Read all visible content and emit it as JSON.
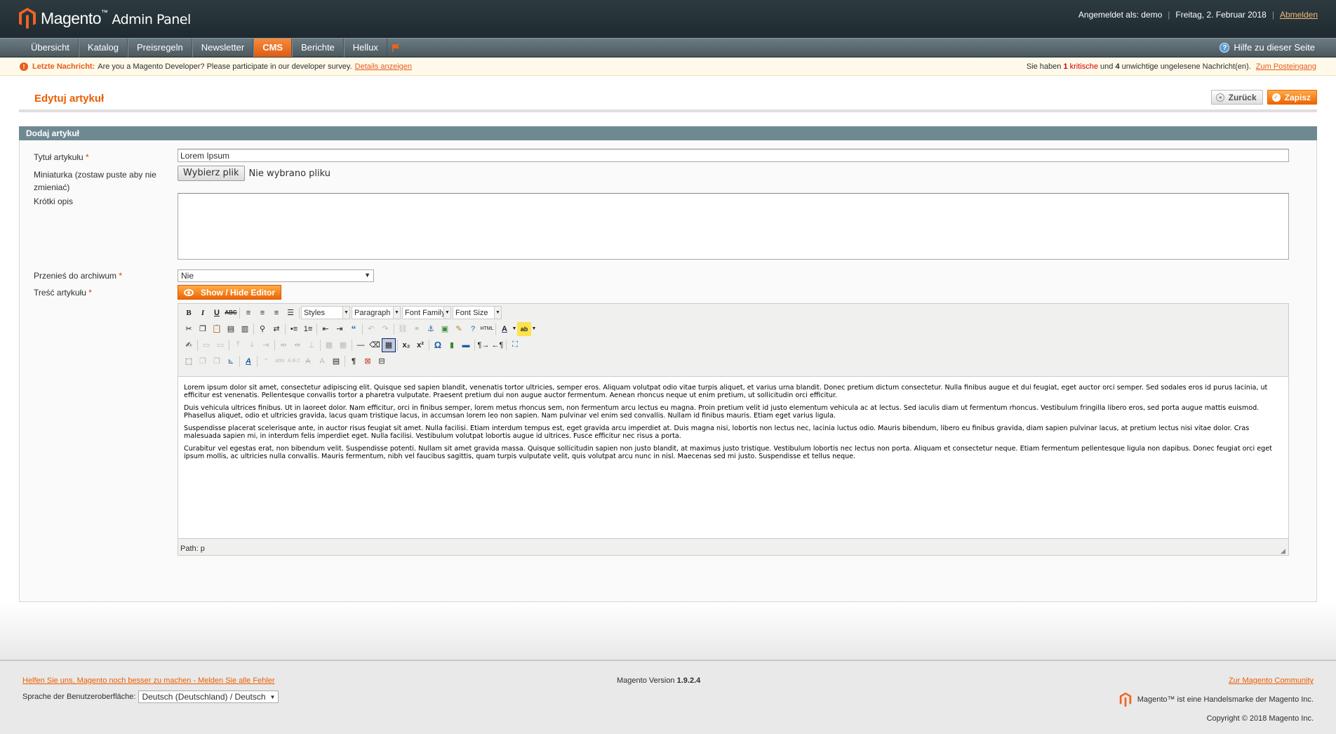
{
  "header": {
    "logo_brand": "Magento",
    "logo_tm": "™",
    "logo_suffix": "Admin Panel",
    "logged_in": "Angemeldet als: demo",
    "date": "Freitag, 2. Februar 2018",
    "logout": "Abmelden"
  },
  "nav": {
    "items": [
      "Übersicht",
      "Katalog",
      "Preisregeln",
      "Newsletter",
      "CMS",
      "Berichte",
      "Hellux"
    ],
    "active": "CMS",
    "help": "Hilfe zu dieser Seite"
  },
  "notice": {
    "label": "Letzte Nachricht:",
    "text": "Are you a Magento Developer? Please participate in our developer survey.",
    "link": "Details anzeigen",
    "right_prefix": "Sie haben",
    "crit_count": "1",
    "crit_label": "kritische",
    "mid": "und",
    "major_count": "4",
    "right_suffix": "unwichtige ungelesene Nachricht(en).",
    "inbox_link": "Zum Posteingang"
  },
  "page": {
    "title": "Edytuj artykuł",
    "back": "Zurück",
    "save": "Zapisz"
  },
  "form": {
    "section": "Dodaj artykuł",
    "title_label": "Tytuł artykułu",
    "title_value": "Lorem Ipsum",
    "thumb_label": "Miniaturka (zostaw puste aby nie zmieniać)",
    "file_button": "Wybierz plik",
    "file_status": "Nie wybrano pliku",
    "short_label": "Krótki opis",
    "archive_label": "Przenieś do archiwum",
    "archive_value": "Nie",
    "content_label": "Treść artykułu",
    "toggle_editor": "Show / Hide Editor",
    "required_mark": "*"
  },
  "editor": {
    "styles": "Styles",
    "format": "Paragraph",
    "font_family": "Font Family",
    "font_size": "Font Size",
    "path": "Path: p",
    "paragraphs": [
      "Lorem ipsum dolor sit amet, consectetur adipiscing elit. Quisque sed sapien blandit, venenatis tortor ultricies, semper eros. Aliquam volutpat odio vitae turpis aliquet, et varius urna blandit. Donec pretium dictum consectetur. Nulla finibus augue et dui feugiat, eget auctor orci semper. Sed sodales eros id purus lacinia, ut efficitur est venenatis. Pellentesque convallis tortor a pharetra vulputate. Praesent pretium dui non augue auctor fermentum. Aenean rhoncus neque ut enim pretium, ut sollicitudin orci efficitur.",
      "Duis vehicula ultrices finibus. Ut in laoreet dolor. Nam efficitur, orci in finibus semper, lorem metus rhoncus sem, non fermentum arcu lectus eu magna. Proin pretium velit id justo elementum vehicula ac at lectus. Sed iaculis diam ut fermentum rhoncus. Vestibulum fringilla libero eros, sed porta augue mattis euismod. Phasellus aliquet, odio et ultricies gravida, lacus quam tristique lacus, in accumsan lorem leo non sapien. Nam pulvinar vel enim sed convallis. Nullam id finibus mauris. Etiam eget varius ligula.",
      "Suspendisse placerat scelerisque ante, in auctor risus feugiat sit amet. Nulla facilisi. Etiam interdum tempus est, eget gravida arcu imperdiet at. Duis magna nisi, lobortis non lectus nec, lacinia luctus odio. Mauris bibendum, libero eu finibus gravida, diam sapien pulvinar lacus, at pretium lectus nisi vitae dolor. Cras malesuada sapien mi, in interdum felis imperdiet eget. Nulla facilisi. Vestibulum volutpat lobortis augue id ultrices. Fusce efficitur nec risus a porta.",
      "Curabitur vel egestas erat, non bibendum velit. Suspendisse potenti. Nullam sit amet gravida massa. Quisque sollicitudin sapien non justo blandit, at maximus justo tristique. Vestibulum lobortis nec lectus non porta. Aliquam et consectetur neque. Etiam fermentum pellentesque ligula non dapibus. Donec feugiat orci eget ipsum mollis, ac ultricies nulla convallis. Mauris fermentum, nibh vel faucibus sagittis, quam turpis vulputate velit, quis volutpat arcu nunc in nisl. Maecenas sed mi justo. Suspendisse et tellus neque."
    ]
  },
  "footer": {
    "bug_link": "Helfen Sie uns, Magento noch besser zu machen - Melden Sie alle Fehler",
    "lang_label": "Sprache der Benutzeroberfläche:",
    "lang_value": "Deutsch (Deutschland) / Deutsch",
    "version_label": "Magento Version",
    "version": "1.9.2.4",
    "community_link": "Zur Magento Community",
    "trademark": "Magento™ ist eine Handelsmarke der Magento Inc.",
    "copyright": "Copyright © 2018 Magento Inc."
  },
  "colors": {
    "accent": "#eb5e00",
    "header_bg": "#2d3b40",
    "section_bg": "#6f8992"
  }
}
